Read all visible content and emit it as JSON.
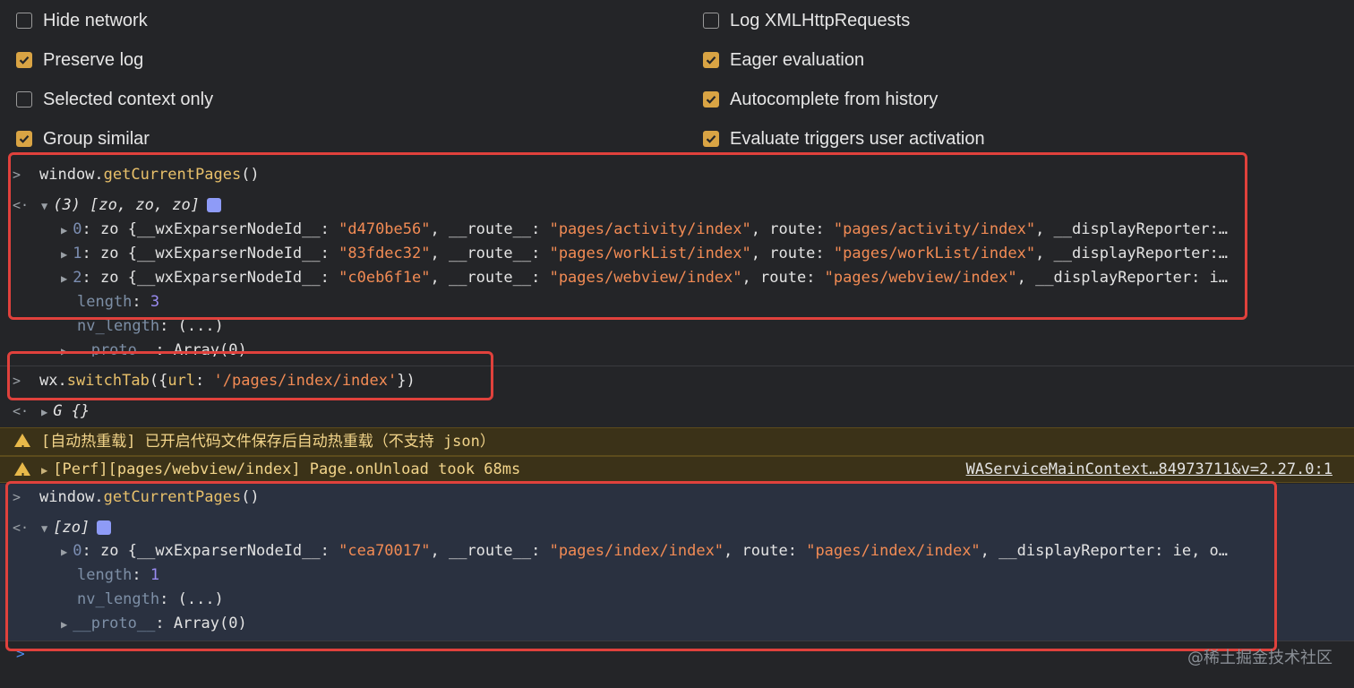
{
  "settings": {
    "left": [
      {
        "label": "Hide network",
        "checked": false
      },
      {
        "label": "Preserve log",
        "checked": true
      },
      {
        "label": "Selected context only",
        "checked": false
      },
      {
        "label": "Group similar",
        "checked": true
      }
    ],
    "right": [
      {
        "label": "Log XMLHttpRequests",
        "checked": false
      },
      {
        "label": "Eager evaluation",
        "checked": true
      },
      {
        "label": "Autocomplete from history",
        "checked": true
      },
      {
        "label": "Evaluate triggers user activation",
        "checked": true
      }
    ]
  },
  "console": {
    "input1": {
      "obj": "window.",
      "method": "getCurrentPages",
      "args": "()"
    },
    "result1": {
      "summary": "(3) [zo, zo, zo]"
    },
    "items1": [
      {
        "idx": "0",
        "cls": "zo",
        "nodeId": "\"d470be56\"",
        "route_": "\"pages/activity/index\"",
        "route": "\"pages/activity/index\"",
        "tail": ", __displayReporter:…"
      },
      {
        "idx": "1",
        "cls": "zo",
        "nodeId": "\"83fdec32\"",
        "route_": "\"pages/workList/index\"",
        "route": "\"pages/workList/index\"",
        "tail": ", __displayReporter:…"
      },
      {
        "idx": "2",
        "cls": "zo",
        "nodeId": "\"c0eb6f1e\"",
        "route_": "\"pages/webview/index\"",
        "route": "\"pages/webview/index\"",
        "tail": ", __displayReporter: i…"
      }
    ],
    "length1": {
      "key": "length",
      "val": "3"
    },
    "nvlength1": {
      "key": "nv_length",
      "val": "(...)"
    },
    "proto1": {
      "key": "__proto__",
      "val": "Array(0)"
    },
    "input2": {
      "obj": "wx.",
      "method": "switchTab",
      "open": "({",
      "key": "url",
      "val": "'/pages/index/index'",
      "close": "})"
    },
    "result2": {
      "summary": "G {}"
    },
    "warn1": {
      "text": "[自动热重载] 已开启代码文件保存后自动热重载（不支持 json）"
    },
    "warn2": {
      "text": "[Perf][pages/webview/index] Page.onUnload took 68ms",
      "link": "WAServiceMainContext…84973711&v=2.27.0:1"
    },
    "input3": {
      "obj": "window.",
      "method": "getCurrentPages",
      "args": "()"
    },
    "result3": {
      "summary": "[zo]"
    },
    "items3": [
      {
        "idx": "0",
        "cls": "zo",
        "nodeId": "\"cea70017\"",
        "route_": "\"pages/index/index\"",
        "route": "\"pages/index/index\"",
        "tail": ", __displayReporter: ie, o…"
      }
    ],
    "length3": {
      "key": "length",
      "val": "1"
    },
    "nvlength3": {
      "key": "nv_length",
      "val": "(...)"
    },
    "proto3": {
      "key": "__proto__",
      "val": "Array(0)"
    }
  },
  "labels": {
    "nodeIdKey": "__wxExparserNodeId__",
    "routeKey": "__route__",
    "routePlainKey": "route"
  },
  "watermark": "@稀土掘金技术社区",
  "colors": {
    "accent_checkbox": "#d9a444",
    "highlight_box": "#e0413c",
    "string": "#f28b54",
    "number": "#9a8cf2"
  }
}
